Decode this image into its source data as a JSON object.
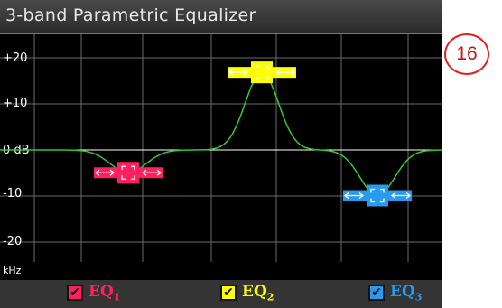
{
  "window": {
    "title": "3-band Parametric Equalizer"
  },
  "axis": {
    "y_labels": [
      "+20",
      "+10",
      "0 dB",
      "-10",
      "-20"
    ],
    "x_unit": "kHz"
  },
  "bands": [
    {
      "id": "EQ",
      "sub": "1",
      "checked": true,
      "color": "#ff2060",
      "gain_db": -5
    },
    {
      "id": "EQ",
      "sub": "2",
      "checked": true,
      "color": "#ffff00",
      "gain_db": 17
    },
    {
      "id": "EQ",
      "sub": "3",
      "checked": true,
      "color": "#2a9aef",
      "gain_db": -10
    }
  ],
  "curve_color": "#37c837",
  "badge": "16",
  "check_glyph": "✔"
}
